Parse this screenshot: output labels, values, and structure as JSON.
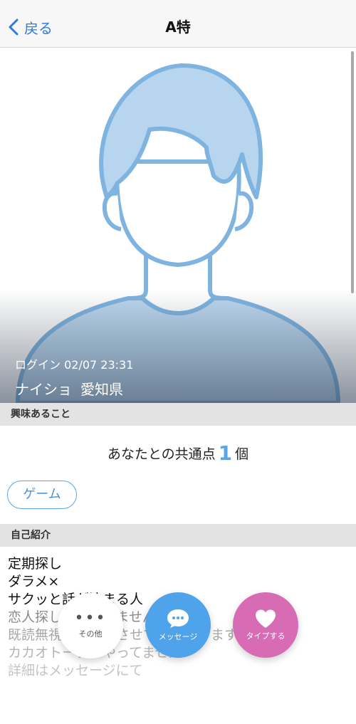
{
  "header": {
    "back_label": "戻る",
    "title": "A特"
  },
  "profile": {
    "login_text": "ログイン 02/07 23:31",
    "name": "ナイショ",
    "location": "愛知県"
  },
  "interests": {
    "section_title": "興味あること",
    "common_prefix": "あなたとの共通点",
    "common_count": "1",
    "common_suffix": "個",
    "tags": [
      "ゲーム"
    ]
  },
  "intro": {
    "section_title": "自己紹介",
    "lines": [
      "定期探し",
      "ダラメ×",
      "サクッと話が決まる人",
      "恋人探しではありません",
      "既読無視ブロックさせていただきます",
      "カカオトークはやってません",
      "詳細はメッセージにて"
    ]
  },
  "actions": {
    "other_label": "その他",
    "message_label": "メッセージ",
    "like_label": "タイプする"
  },
  "colors": {
    "accent_blue": "#2b7de0",
    "message_blue": "#4fa3ea",
    "like_pink": "#d76cb5",
    "avatar_blue": "#b7d5ee"
  }
}
